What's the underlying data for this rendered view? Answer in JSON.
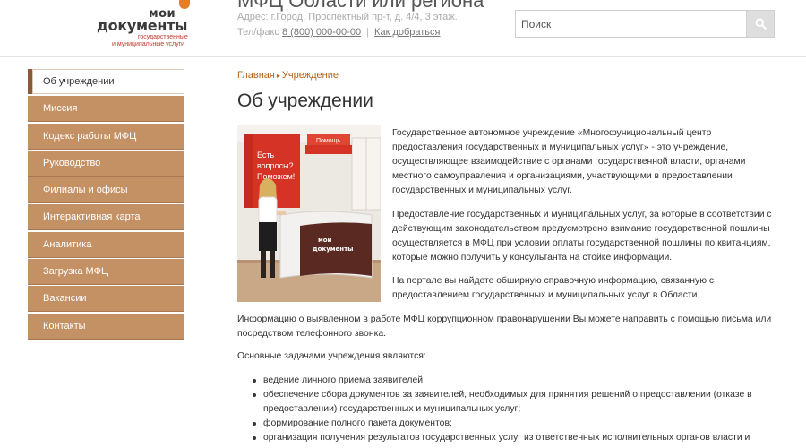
{
  "header": {
    "logo": {
      "line1": "мои",
      "line2": "документы",
      "sub1": "государственные",
      "sub2": "и муниципальные услуги"
    },
    "site_title": "МФЦ Области или региона",
    "address": "Адрес: г.Город, Проспектный пр-т, д. 4/4, 3 этаж.",
    "phone_label": "Тел/факс",
    "phone": "8 (800) 000-00-00",
    "separator": "|",
    "directions_link": "Как добраться",
    "search": {
      "placeholder": "Поиск",
      "button_icon": "search-icon"
    }
  },
  "sidebar": {
    "items": [
      {
        "label": "Об учреждении",
        "active": true
      },
      {
        "label": "Миссия"
      },
      {
        "label": "Кодекс работы МФЦ"
      },
      {
        "label": "Руководство"
      },
      {
        "label": "Филиалы и офисы"
      },
      {
        "label": "Интерактивная карта"
      },
      {
        "label": "Аналитика"
      },
      {
        "label": "Загрузка МФЦ"
      },
      {
        "label": "Вакансии"
      },
      {
        "label": "Контакты"
      }
    ]
  },
  "main": {
    "breadcrumb": {
      "home": "Главная",
      "current": "Учреждение",
      "separator": "▸"
    },
    "title": "Об учреждении",
    "photo": {
      "sign_text1": "Есть",
      "sign_text2": "вопросы?",
      "sign_text3": "Поможем!",
      "help_label": "Помощь",
      "desk_logo1": "мои",
      "desk_logo2": "документы"
    },
    "paragraphs": [
      "Государственное автономное учреждение «Многофункциональный центр предоставления государственных и муниципальных услуг» -  это учреждение, осуществляющее взаимодействие с органами государственной власти, органами местного самоуправления и организациями, участвующими в предоставлении государственных и муниципальных услуг.",
      "Предоставление государственных и муниципальных услуг, за которые в соответствии с действующим законодательством предусмотрено взимание государственной пошлины осуществляется в МФЦ при условии оплаты государственной пошлины по квитанциям, которые можно получить у консультанта на стойке информации.",
      "На портале вы найдете обширную справочную информацию, связанную с предоставлением государственных и муниципальных услуг в  Области.",
      "Информацию о выявленном в работе МФЦ коррупционном правонарушении Вы можете направить с помощью письма или посредством телефонного звонка.",
      "Основные задачами учреждения являются:"
    ],
    "tasks": [
      "ведение личного приема заявителей;",
      "обеспечение сбора документов за заявителей, необходимых для принятия решений о предоставлении (отказе в предоставлении) государственных и муниципальных услуг;",
      "формирование полного пакета документов;",
      "организация получения результатов государственных услуг из ответственных исполнительных органов власти и"
    ]
  },
  "colors": {
    "accent_brown": "#c49165",
    "link": "#b5651d",
    "logo_orange": "#e67e22"
  }
}
